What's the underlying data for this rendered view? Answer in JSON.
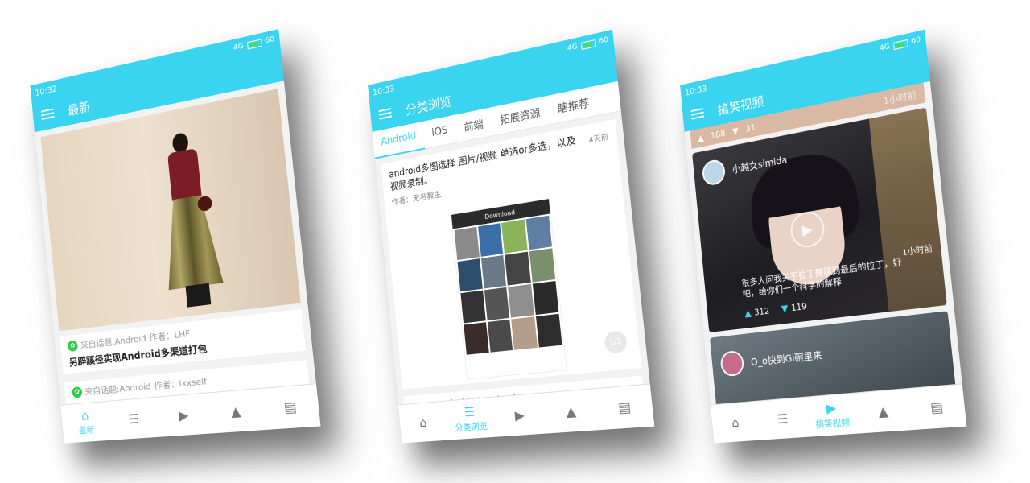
{
  "phones": [
    {
      "status": {
        "time": "10:32",
        "network": "4G",
        "battery": "60"
      },
      "appbar_title": "最新",
      "cards": [
        {
          "source": "来自话题:Android",
          "author": "作者：LHF",
          "title": "另辟蹊径实现Android多渠道打包"
        },
        {
          "source": "来自话题:Android",
          "author": "作者：lxxself",
          "title": ""
        }
      ],
      "nav": [
        "最新",
        "",
        "",
        "",
        ""
      ]
    },
    {
      "status": {
        "time": "10:33",
        "network": "4G",
        "battery": "60"
      },
      "appbar_title": "分类浏览",
      "tabs": [
        "Android",
        "iOS",
        "前端",
        "拓展资源",
        "瞎推荐"
      ],
      "card": {
        "title": "android多图选择 图片/视频 单选or多选，以及视频录制。",
        "time": "4天前",
        "author": "作者：无名教主",
        "shot_title": "Download",
        "pager": "1/2"
      },
      "card2_title": "top-5-android-libraries-january-2017",
      "nav": [
        "",
        "分类浏览",
        "",
        "",
        ""
      ]
    },
    {
      "status": {
        "time": "10:33",
        "network": "4G",
        "battery": "60"
      },
      "appbar_title": "搞笑视频",
      "top_strip": {
        "likes": "188",
        "dislikes": "31",
        "time": "1小时前"
      },
      "video": {
        "user": "小越女simida",
        "caption": "很多人问我关于拉丁舞跳到最后的拉丁，好吧，给你们一个科学的解释",
        "time": "1小时前",
        "likes": "312",
        "dislikes": "119"
      },
      "video2_user": "O_o快到Gl碗里来",
      "nav": [
        "",
        "",
        "搞笑视频",
        "",
        ""
      ]
    }
  ],
  "colors": {
    "accent": "#3ad4f0",
    "card": "#ffffff"
  }
}
